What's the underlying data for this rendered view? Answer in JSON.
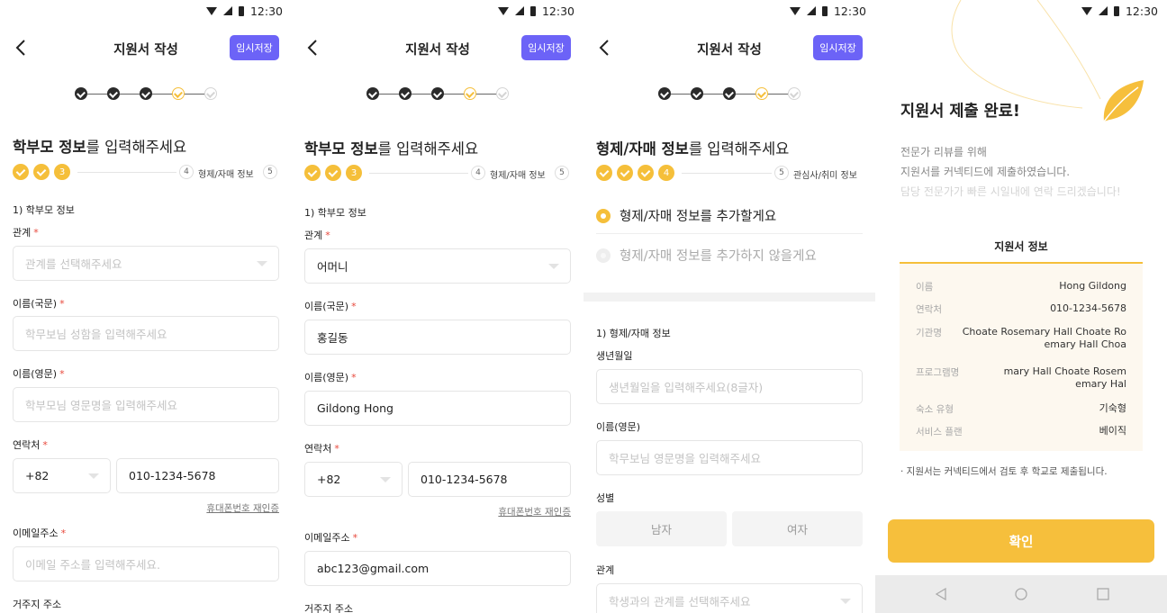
{
  "status": {
    "time": "12:30"
  },
  "header": {
    "title": "지원서 작성",
    "save_label": "임시저장"
  },
  "screen1": {
    "heading_bold": "학부모 정보",
    "heading_rest": "를 입력해주세요",
    "step_current": "3",
    "step_next_num": "4",
    "step_next_label": "형제/자매 정보",
    "step_last": "5",
    "section": "1) 학부모 정보",
    "relation_label": "관계",
    "relation_placeholder": "관계를 선택해주세요",
    "name_kr_label": "이름(국문)",
    "name_kr_placeholder": "학무보님 성함을 입력해주세요",
    "name_en_label": "이름(영문)",
    "name_en_placeholder": "학부모님 영문명을 입력해주세요",
    "phone_label": "연락처",
    "country_code": "+82",
    "phone_value": "010-1234-5678",
    "reverify": "휴대폰번호 재인증",
    "email_label": "이메일주소",
    "email_placeholder": "이메일 주소를 입력해주세요.",
    "address_label": "거주지 주소"
  },
  "screen2": {
    "heading_bold": "학부모 정보",
    "heading_rest": "를 입력해주세요",
    "step_current": "3",
    "step_next_num": "4",
    "step_next_label": "형제/자매 정보",
    "step_last": "5",
    "section": "1) 학부모 정보",
    "relation_label": "관계",
    "relation_value": "어머니",
    "name_kr_label": "이름(국문)",
    "name_kr_value": "홍길동",
    "name_en_label": "이름(영문)",
    "name_en_value": "Gildong Hong",
    "phone_label": "연락처",
    "country_code": "+82",
    "phone_value": "010-1234-5678",
    "reverify": "휴대폰번호 재인증",
    "email_label": "이메일주소",
    "email_value": "abc123@gmail.com",
    "address_label": "거주지 주소"
  },
  "screen3": {
    "heading_bold": "형제/자매 정보",
    "heading_rest": "를 입력해주세요",
    "step_current": "4",
    "step_next_num": "5",
    "step_next_label": "관심사/취미 정보",
    "option_add": "형제/자매 정보를 추가할게요",
    "option_skip": "형제/자매 정보를 추가하지 않을게요",
    "section": "1) 형제/자매 정보",
    "dob_label": "생년월일",
    "dob_placeholder": "생년월일을 입력해주세요(8글자)",
    "name_en_label": "이름(영문)",
    "name_en_placeholder": "학무보님 영문명을 입력해주세요",
    "gender_label": "성별",
    "male": "남자",
    "female": "여자",
    "relation_label": "관계",
    "relation_placeholder": "학생과의 관계를 선택해주세요"
  },
  "screen4": {
    "title": "지원서 제출 완료!",
    "line1": "전문가 리뷰를 위해",
    "line2": "지원서를 커넥티드에 제출하였습니다.",
    "line3": "담당 전문가가 빠른 시일내에 연락 드리겠습니다!",
    "info_title": "지원서 정보",
    "name_key": "이름",
    "name_val": "Hong Gildong",
    "phone_key": "연락처",
    "phone_val": "010-1234-5678",
    "org_key": "기관명",
    "org_val1": "Choate Rosemary Hall Choate Ro",
    "org_val2": "emary Hall Choa",
    "program_key": "프로그램명",
    "program_val1": "mary Hall Choate Rosem",
    "program_val2": "emary Hal",
    "stay_key": "숙소 유형",
    "stay_val": "기숙형",
    "plan_key": "서비스 플랜",
    "plan_val": "베이직",
    "note": "· 지원서는 커넥티드에서 검토 후 학교로 제출됩니다.",
    "confirm": "확인"
  },
  "colors": {
    "accent_purple": "#6c63f7",
    "accent_yellow": "#f5bf3a",
    "required_red": "#e8483b"
  },
  "icons": [
    "back-arrow-icon",
    "wifi-icon",
    "signal-icon",
    "battery-icon",
    "check-icon",
    "feather-icon",
    "nav-back-icon",
    "nav-home-icon",
    "nav-recent-icon",
    "dropdown-arrow-icon"
  ]
}
